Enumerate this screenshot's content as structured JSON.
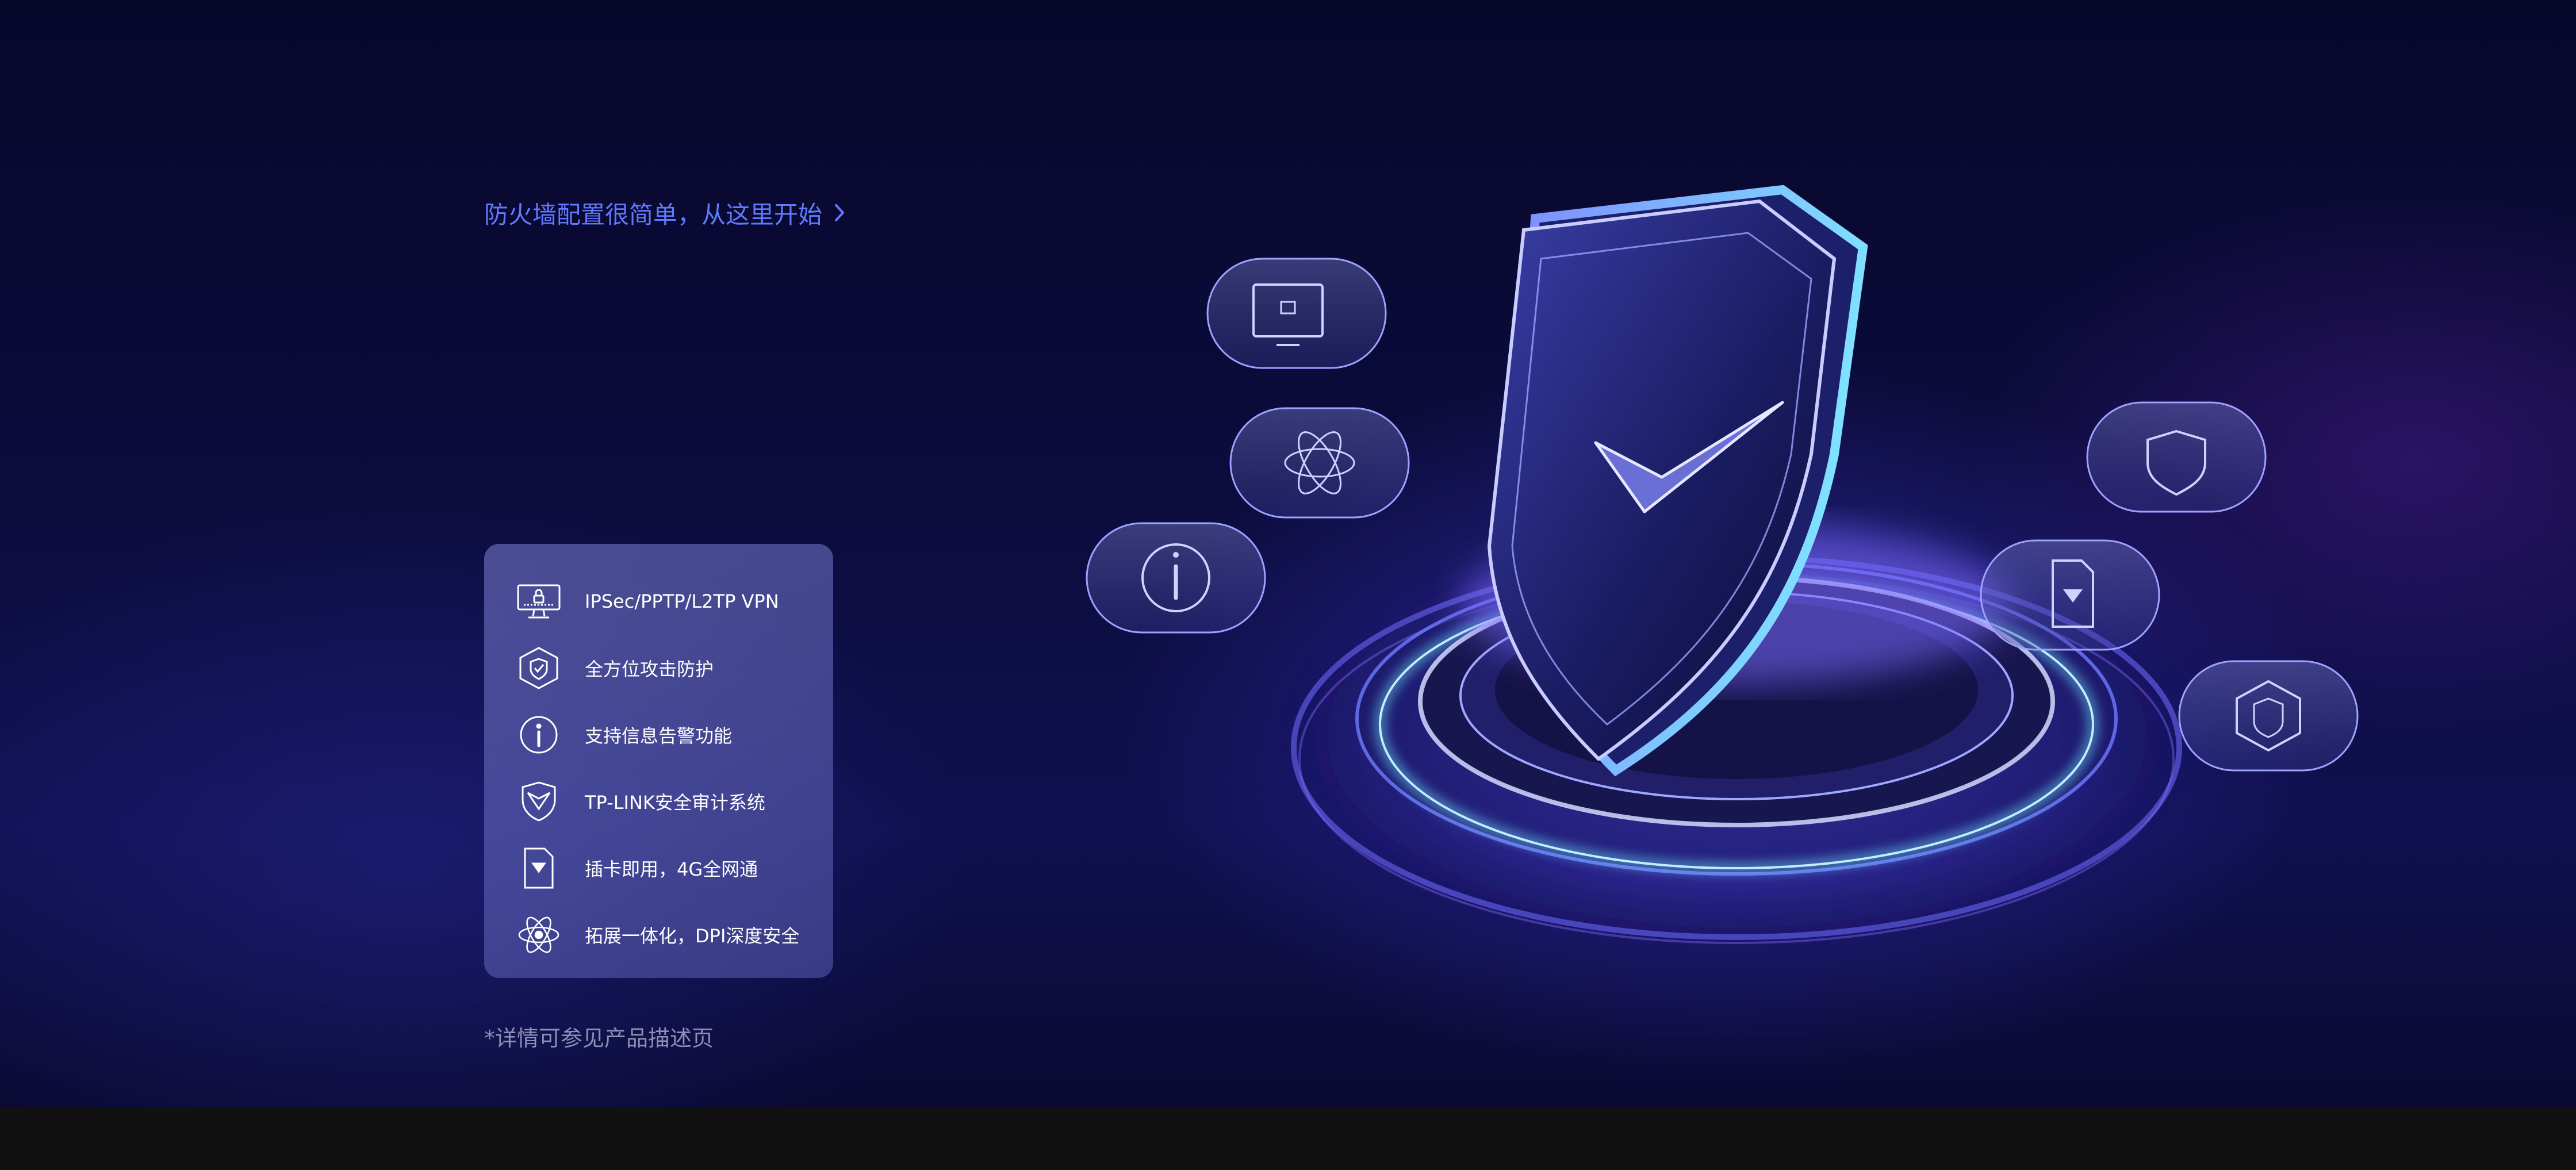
{
  "hero": {
    "cta_link": "防火墙配置很简单，从这里开始",
    "features": [
      {
        "icon": "vpn-monitor-icon",
        "label": "IPSec/PPTP/L2TP VPN"
      },
      {
        "icon": "hexagon-shield-icon",
        "label": "全方位攻击防护"
      },
      {
        "icon": "info-icon",
        "label": "支持信息告警功能"
      },
      {
        "icon": "shield-check-icon",
        "label": "TP-LINK安全审计系统"
      },
      {
        "icon": "sim-card-icon",
        "label": "插卡即用，4G全网通"
      },
      {
        "icon": "atom-dpi-icon",
        "label": "拓展一体化，DPI深度安全"
      }
    ],
    "footnote": "*详情可参见产品描述页"
  },
  "colors": {
    "background": "#0c0c3e",
    "accent_link": "#5f79ff",
    "card": "#6c70c0",
    "bottom_band": "#111112"
  }
}
